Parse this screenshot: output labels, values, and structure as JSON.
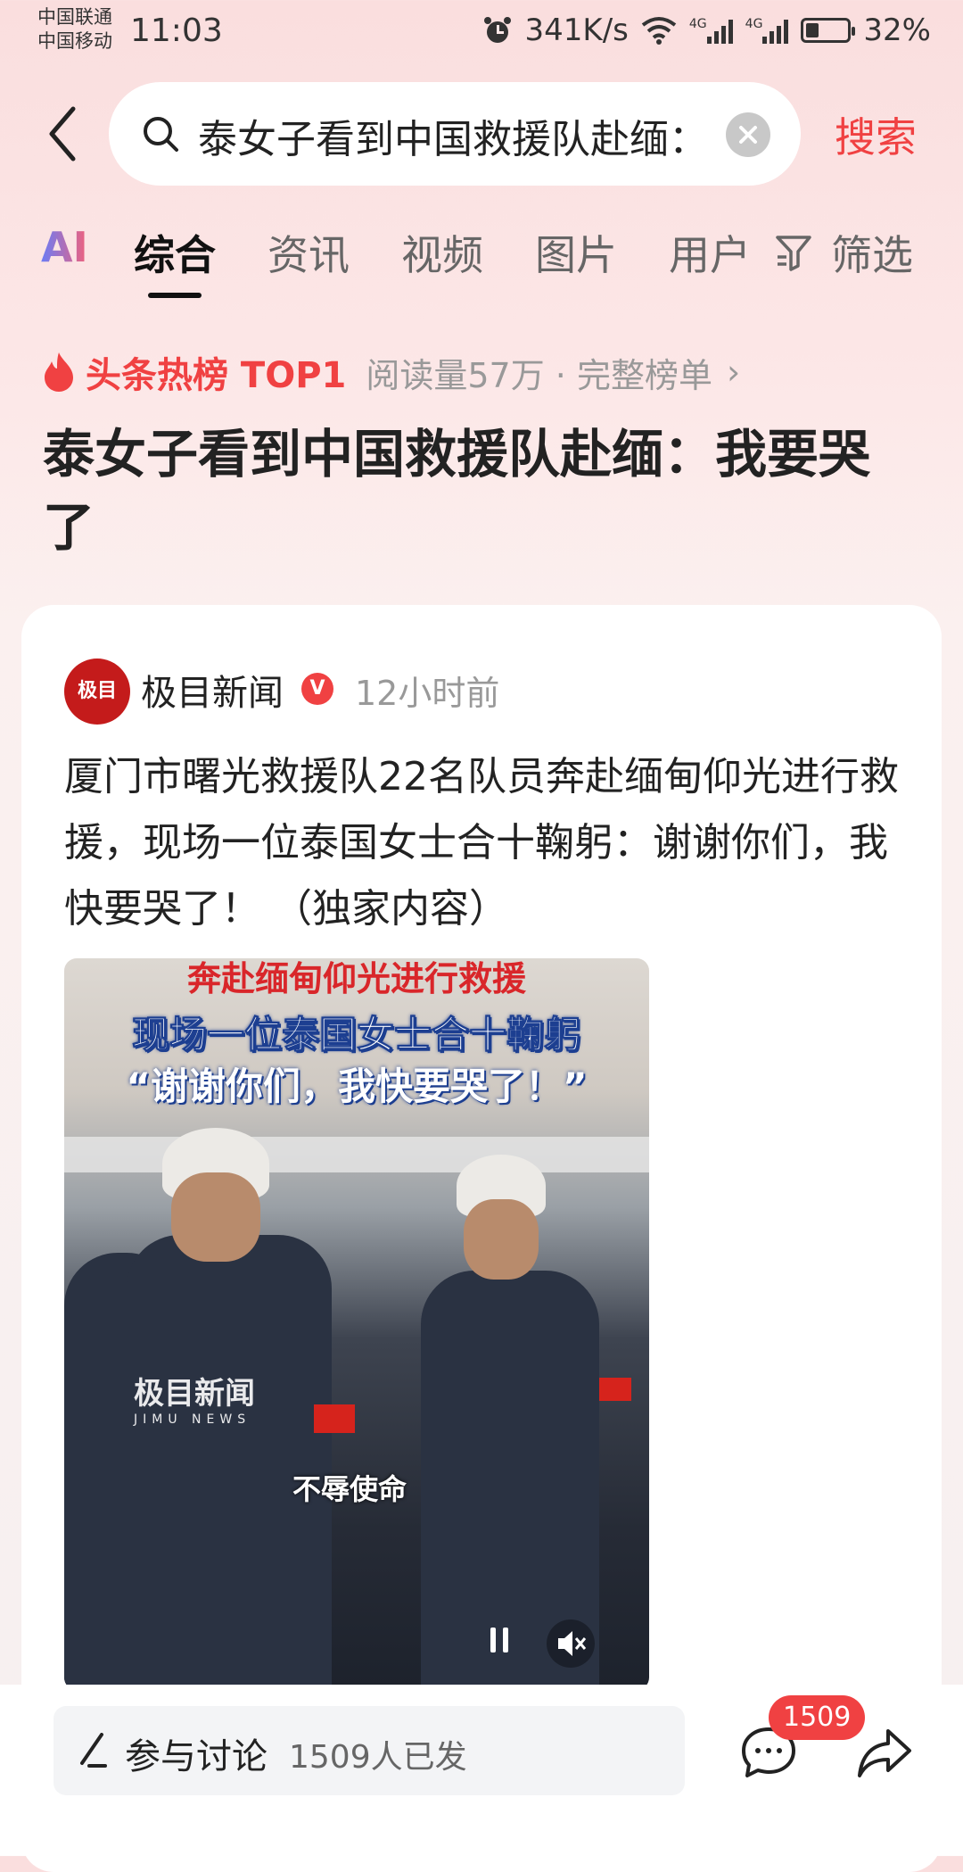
{
  "status_bar": {
    "carrier_1": "中国联通",
    "carrier_2": "中国移动",
    "time": "11:03",
    "speed": "341K/s",
    "network_1": "4G",
    "network_2": "4G",
    "battery": "32%",
    "battery_level": 0.32
  },
  "search": {
    "query": "泰女子看到中国救援队赴缅：",
    "button": "搜索"
  },
  "tabs": {
    "ai": "AI",
    "items": [
      "综合",
      "资讯",
      "视频",
      "图片",
      "用户"
    ],
    "active_index": 0,
    "filter": "筛选"
  },
  "hot": {
    "rank_label": "头条热榜 TOP1",
    "meta": "阅读量57万 · 完整榜单",
    "chevron": "›"
  },
  "headline": "泰女子看到中国救援队赴缅：我要哭了",
  "article": {
    "source": "极目新闻",
    "avatar_text": "极目",
    "verified": "V",
    "time": "12小时前",
    "summary": "厦门市曙光救援队22名队员奔赴缅甸仰光进行救援，现场一位泰国女士合十鞠躬：谢谢你们，我快要哭了！ （独家内容）"
  },
  "video": {
    "line1": "奔赴缅甸仰光进行救援",
    "line2": "现场一位泰国女士合十鞠躬",
    "line3": "“谢谢你们，我快要哭了！”",
    "watermark": "极目新闻",
    "watermark_en": "JIMU NEWS",
    "caption": "不辱使命"
  },
  "bottom": {
    "discuss_label": "参与讨论",
    "discuss_count": "1509人已发",
    "comment_badge": "1509"
  },
  "colors": {
    "accent": "#f04142",
    "background": "#fce7e7"
  }
}
